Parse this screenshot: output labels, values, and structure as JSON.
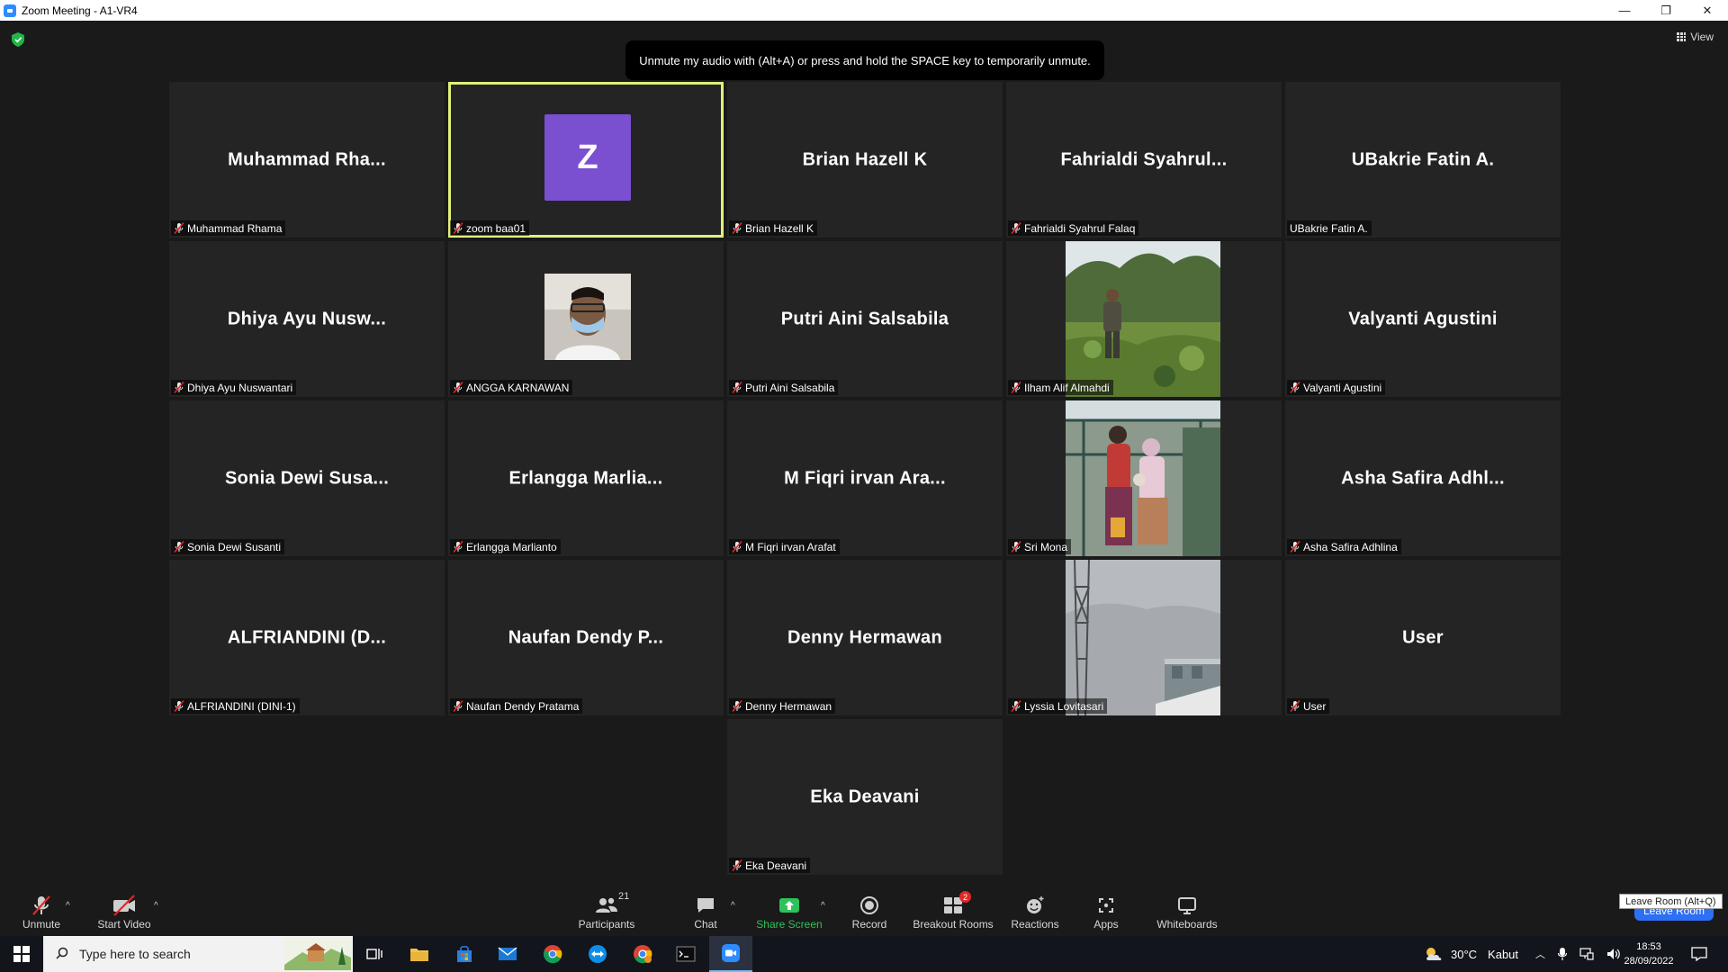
{
  "window": {
    "title": "Zoom Meeting - A1-VR4",
    "minimize": "—",
    "restore": "❐",
    "close": "✕"
  },
  "meeting": {
    "view_label": "View",
    "toast": "Unmute my audio with (Alt+A) or press and hold the SPACE key to temporarily unmute."
  },
  "tiles": [
    {
      "big": "Muhammad  Rha...",
      "label": "Muhammad Rhama",
      "muted": true
    },
    {
      "big": "",
      "label": "zoom baa01",
      "muted": true,
      "avatar": "Z",
      "active": true
    },
    {
      "big": "Brian Hazell K",
      "label": "Brian Hazell K",
      "muted": true
    },
    {
      "big": "Fahrialdi  Syahrul...",
      "label": "Fahrialdi Syahrul Falaq",
      "muted": true
    },
    {
      "big": "UBakrie Fatin A.",
      "label": "UBakrie Fatin A.",
      "muted": false
    },
    {
      "big": "Dhiya  Ayu  Nusw...",
      "label": "Dhiya Ayu Nuswantari",
      "muted": true
    },
    {
      "big": "",
      "label": "ANGGA KARNAWAN",
      "muted": true,
      "photo": "face"
    },
    {
      "big": "Putri Aini Salsabila",
      "label": "Putri Aini Salsabila",
      "muted": true
    },
    {
      "big": "",
      "label": "Ilham Alif Almahdi",
      "muted": true,
      "photo": "garden"
    },
    {
      "big": "Valyanti Agustini",
      "label": "Valyanti Agustini",
      "muted": true
    },
    {
      "big": "Sonia  Dewi  Susa...",
      "label": "Sonia Dewi Susanti",
      "muted": true
    },
    {
      "big": "Erlangga  Marlia...",
      "label": "Erlangga Marlianto",
      "muted": true
    },
    {
      "big": "M Fiqri irvan Ara...",
      "label": "M Fiqri irvan Arafat",
      "muted": true
    },
    {
      "big": "",
      "label": "Sri Mona",
      "muted": true,
      "photo": "family"
    },
    {
      "big": "Asha  Safira  Adhl...",
      "label": "Asha Safira Adhlina",
      "muted": true
    },
    {
      "big": "ALFRIANDINI  (D...",
      "label": "ALFRIANDINI (DINI-1)",
      "muted": true
    },
    {
      "big": "Naufan  Dendy  P...",
      "label": "Naufan Dendy Pratama",
      "muted": true
    },
    {
      "big": "Denny Hermawan",
      "label": "Denny Hermawan",
      "muted": true
    },
    {
      "big": "",
      "label": "Lyssia Lovitasari",
      "muted": true,
      "photo": "sky"
    },
    {
      "big": "User",
      "label": "User",
      "muted": true
    },
    {
      "big": "Eka Deavani",
      "label": "Eka Deavani",
      "muted": true
    }
  ],
  "toolbar": {
    "unmute": "Unmute",
    "start_video": "Start Video",
    "participants": "Participants",
    "participants_count": "21",
    "chat": "Chat",
    "share_screen": "Share Screen",
    "record": "Record",
    "breakout_rooms": "Breakout Rooms",
    "breakout_badge": "2",
    "reactions": "Reactions",
    "apps": "Apps",
    "whiteboards": "Whiteboards",
    "leave_tooltip": "Leave Room (Alt+Q)",
    "leave_button": "Leave Room"
  },
  "taskbar": {
    "search_placeholder": "Type here to search",
    "weather_temp": "30°C",
    "weather_text": "Kabut",
    "time": "18:53",
    "date": "28/09/2022"
  },
  "colors": {
    "active_border": "#e1f07a",
    "avatar_bg": "#7a4fd0",
    "share_green": "#2fc25a",
    "badge_red": "#e02828",
    "leave_blue": "#2d6ff5"
  }
}
